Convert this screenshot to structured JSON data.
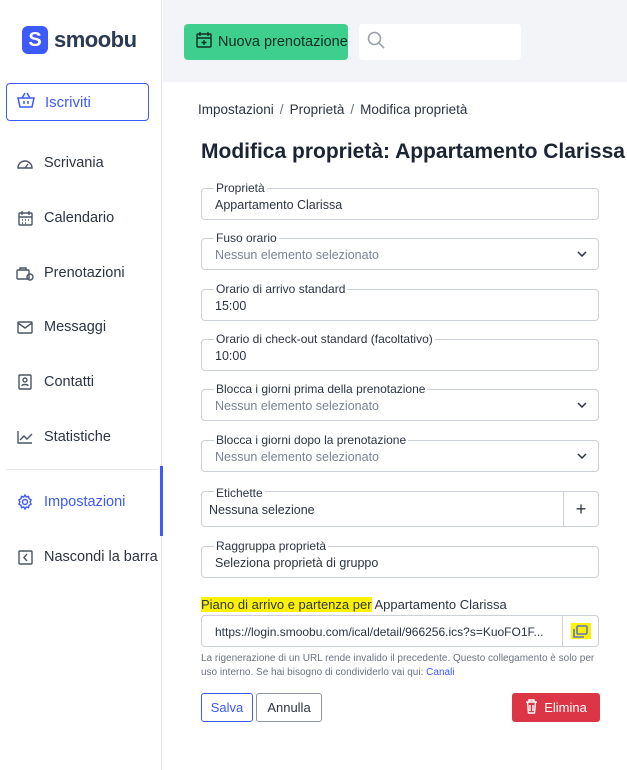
{
  "brand": {
    "logo_letter": "S",
    "name": "smoobu",
    "accent": "#3d5afe"
  },
  "sidebar": {
    "subscribe_label": "Iscriviti",
    "items": [
      {
        "label": "Scrivania",
        "icon": "dashboard-icon"
      },
      {
        "label": "Calendario",
        "icon": "calendar-icon"
      },
      {
        "label": "Prenotazioni",
        "icon": "bookings-icon"
      },
      {
        "label": "Messaggi",
        "icon": "mail-icon"
      },
      {
        "label": "Contatti",
        "icon": "contacts-icon"
      },
      {
        "label": "Statistiche",
        "icon": "chart-icon"
      },
      {
        "label": "Impostazioni",
        "icon": "gear-icon",
        "active": true
      },
      {
        "label": "Nascondi la barra",
        "icon": "collapse-icon"
      }
    ]
  },
  "header": {
    "new_booking_label": "Nuova prenotazione",
    "search_placeholder": ""
  },
  "breadcrumb": [
    "Impostazioni",
    "Proprietà",
    "Modifica proprietà"
  ],
  "page_title": "Modifica proprietà: Appartamento Clarissa",
  "form": {
    "property": {
      "label": "Proprietà",
      "value": "Appartamento Clarissa"
    },
    "timezone": {
      "label": "Fuso orario",
      "value": "Nessun elemento selezionato"
    },
    "arrival_time": {
      "label": "Orario di arrivo standard",
      "value": "15:00"
    },
    "checkout_time": {
      "label": "Orario di check-out standard (facoltativo)",
      "value": "10:00"
    },
    "block_before": {
      "label": "Blocca i giorni prima della prenotazione",
      "value": "Nessun elemento selezionato"
    },
    "block_after": {
      "label": "Blocca i giorni dopo la prenotazione",
      "value": "Nessun elemento selezionato"
    },
    "tags": {
      "label": "Etichette",
      "value": "Nessuna selezione",
      "add_symbol": "+"
    },
    "group": {
      "label": "Raggruppa proprietà",
      "value": "Seleziona proprietà di gruppo"
    }
  },
  "ical": {
    "title_highlight": "Piano di arrivo e partenza per",
    "title_rest": " Appartamento Clarissa",
    "url": "https://login.smoobu.com/ical/detail/966256.ics?s=KuoFO1F...",
    "help_text": "La rigenerazione di un URL rende invalido il precedente. Questo collegamento è solo per uso interno. Se hai bisogno di condividerlo vai qui: ",
    "help_link": "Canali"
  },
  "actions": {
    "save": "Salva",
    "cancel": "Annulla",
    "delete": "Elimina"
  },
  "colors": {
    "green": "#3ecf8e",
    "danger": "#dc3545",
    "highlight": "#fff200"
  }
}
